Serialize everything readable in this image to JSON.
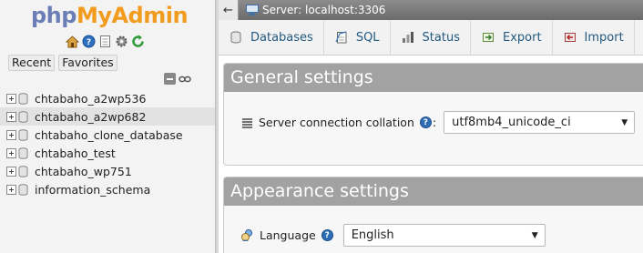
{
  "nav": {
    "logo": {
      "php": "php",
      "my": "My",
      "admin": "Admin"
    },
    "quick_icons": [
      "home-icon",
      "logout-icon",
      "docs-icon",
      "settings-icon",
      "reload-icon"
    ],
    "tabs": {
      "recent": "Recent",
      "favorites": "Favorites"
    },
    "databases": [
      {
        "name": "chtabaho_a2wp536",
        "highlighted": false
      },
      {
        "name": "chtabaho_a2wp682",
        "highlighted": true
      },
      {
        "name": "chtabaho_clone_database",
        "highlighted": false
      },
      {
        "name": "chtabaho_test",
        "highlighted": false
      },
      {
        "name": "chtabaho_wp751",
        "highlighted": false
      },
      {
        "name": "information_schema",
        "highlighted": false
      }
    ]
  },
  "topbar": {
    "server_label": "Server: localhost:3306"
  },
  "main_tabs": [
    {
      "label": "Databases",
      "icon": "database-icon"
    },
    {
      "label": "SQL",
      "icon": "sql-icon"
    },
    {
      "label": "Status",
      "icon": "status-icon"
    },
    {
      "label": "Export",
      "icon": "export-icon"
    },
    {
      "label": "Import",
      "icon": "import-icon"
    }
  ],
  "general_settings": {
    "title": "General settings",
    "collation_label": "Server connection collation",
    "collation_value": "utf8mb4_unicode_ci"
  },
  "appearance_settings": {
    "title": "Appearance settings",
    "language_label": "Language",
    "language_value": "English"
  },
  "colors": {
    "link": "#235a81",
    "panel_header": "#a2a2a2",
    "logo_php": "#6c7eb7",
    "logo_admin": "#f29c1f"
  }
}
